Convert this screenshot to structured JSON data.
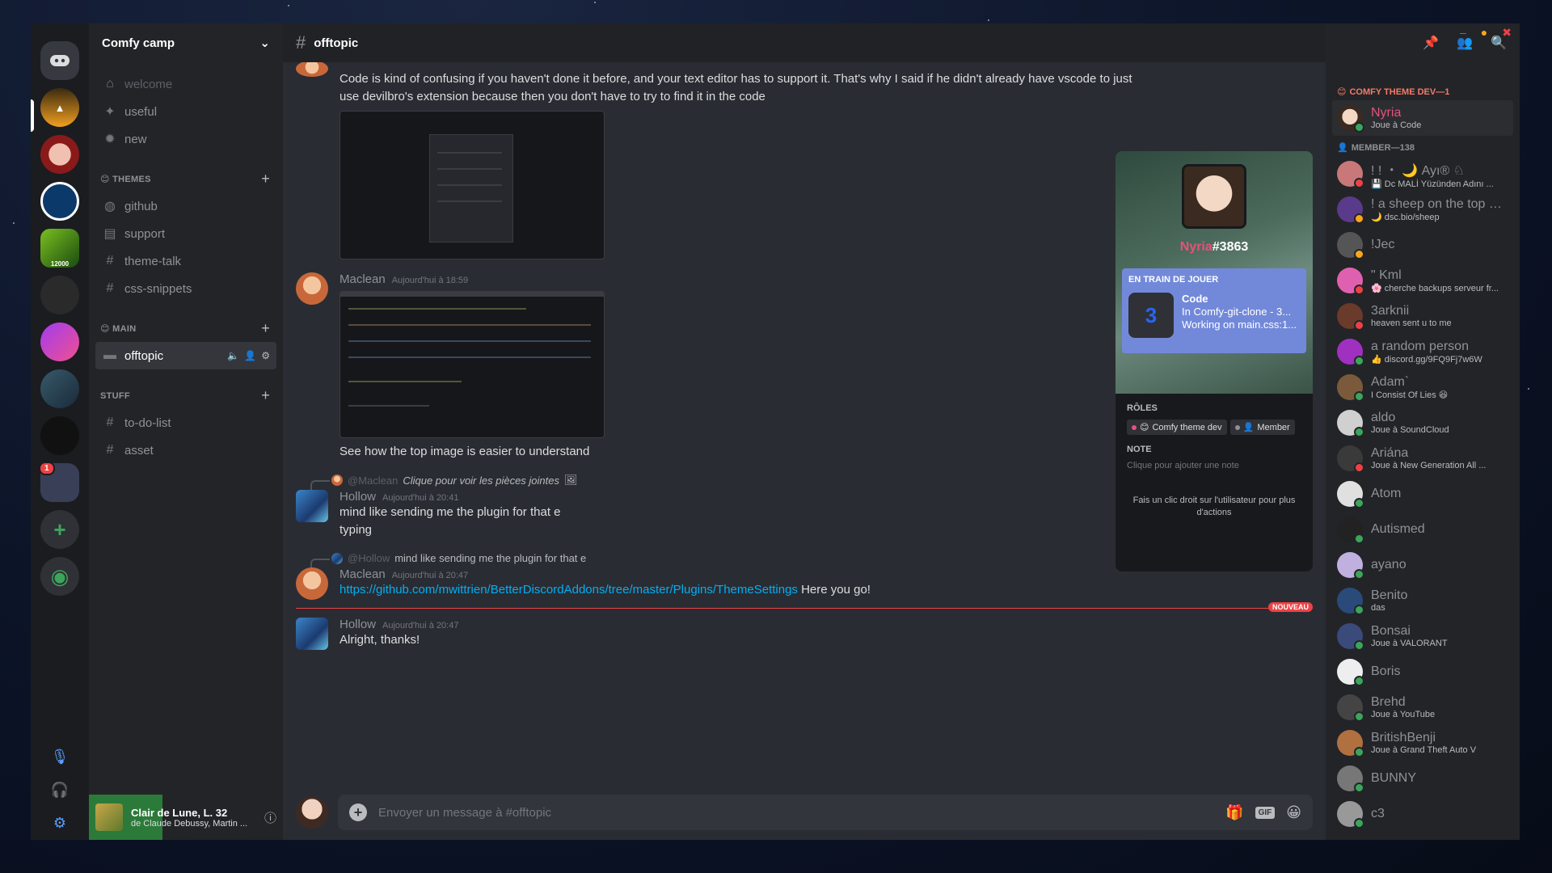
{
  "server": {
    "name": "Comfy camp"
  },
  "rail": {
    "badge": "1",
    "tile_label": "12000"
  },
  "channels": {
    "top": [
      {
        "name": "welcome",
        "icon": "home-icon"
      },
      {
        "name": "useful",
        "icon": "pin-icon"
      },
      {
        "name": "new",
        "icon": "badge-icon"
      }
    ],
    "themes_label": "THEMES",
    "themes": [
      {
        "name": "github",
        "icon": "github-icon"
      },
      {
        "name": "support",
        "icon": "forum-icon"
      },
      {
        "name": "theme-talk",
        "icon": "hash-icon"
      },
      {
        "name": "css-snippets",
        "icon": "hash-icon"
      }
    ],
    "main_label": "MAIN",
    "main": [
      {
        "name": "offtopic",
        "icon": "text-icon",
        "active": true
      }
    ],
    "stuff_label": "STUFF",
    "stuff": [
      {
        "name": "to-do-list",
        "icon": "hash-icon"
      },
      {
        "name": "asset",
        "icon": "hash-icon"
      }
    ]
  },
  "now_playing": {
    "title": "Clair de Lune, L. 32",
    "artist": "de Claude Debussy, Martin ..."
  },
  "chat": {
    "channel": "offtopic",
    "messages": [
      {
        "text": "Code is kind of confusing if you haven't done it before, and your text editor has to support it.  That's why I said if he didn't already have vscode to just use devilbro's extension because then you don't have to try to find it in the code"
      },
      {
        "author": "Maclean",
        "time": "Aujourd'hui à 18:59",
        "text": "See how the top image is easier to understand"
      },
      {
        "reply_mention": "@Maclean",
        "reply_text": "Clique pour voir les pièces jointes",
        "author": "Hollow",
        "time": "Aujourd'hui à 20:41",
        "line1": "mind like sending me the plugin for that e",
        "line2": "typing"
      },
      {
        "reply_mention": "@Hollow",
        "reply_text": "mind like sending me the plugin for that e",
        "author": "Maclean",
        "time": "Aujourd'hui à 20:47",
        "link": "https://github.com/mwittrien/BetterDiscordAddons/tree/master/Plugins/ThemeSettings",
        "after_link": " Here you go!"
      },
      {
        "author": "Hollow",
        "time": "Aujourd'hui à 20:47",
        "text": "Alright, thanks!"
      }
    ],
    "new_label": "NOUVEAU",
    "composer_placeholder": "Envoyer un message à #offtopic",
    "gif_label": "GIF"
  },
  "popout": {
    "name": "Nyria",
    "tag": "#3863",
    "activity_label": "EN TRAIN DE JOUER",
    "activity_game": "Code",
    "activity_line1": "In Comfy-git-clone - 3...",
    "activity_line2": "Working on main.css:1...",
    "roles_label": "RÔLES",
    "roles": [
      {
        "name": "Comfy theme dev",
        "color": "#e5527a"
      },
      {
        "name": "Member",
        "color": "#8e9297"
      }
    ],
    "note_label": "NOTE",
    "note_placeholder": "Clique pour ajouter une note",
    "hint": "Fais un clic droit sur l'utilisateur pour plus d'actions"
  },
  "members": {
    "dev_group": "COMFY THEME DEV—1",
    "member_group": "MEMBER—138",
    "dev": [
      {
        "name": "Nyria",
        "sub": "Joue à Code",
        "color": "#e5527a"
      }
    ],
    "list": [
      {
        "name": "! ! ・ 🌙 Ayı® ♘",
        "sub": "💾 Dc MALİ Yüzünden Adını ...",
        "status": "#ed4245"
      },
      {
        "name": "! a sheep on the top of ...",
        "sub": "🌙 dsc.bio/sheep",
        "status": "#faa61a"
      },
      {
        "name": "!Jec",
        "sub": "",
        "status": "#faa61a"
      },
      {
        "name": "\" Kml",
        "sub": "🌸 cherche backups serveur fr...",
        "status": "#ed4245"
      },
      {
        "name": "3arknii",
        "sub": "heaven sent u to me",
        "status": "#ed4245"
      },
      {
        "name": "a random person",
        "sub": "👍 discord.gg/9FQ9Fj7w6W",
        "status": "#3ba55c"
      },
      {
        "name": "Adam`",
        "sub": "I Consist Of Lies 😆",
        "status": "#3ba55c"
      },
      {
        "name": "aldo",
        "sub": "Joue à SoundCloud",
        "status": "#3ba55c"
      },
      {
        "name": "Ariána",
        "sub": "Joue à New Generation All ...",
        "status": "#ed4245"
      },
      {
        "name": "Atom",
        "sub": "",
        "status": "#3ba55c"
      },
      {
        "name": "Autismed",
        "sub": "",
        "status": "#3ba55c"
      },
      {
        "name": "ayano",
        "sub": "",
        "status": "#3ba55c"
      },
      {
        "name": "Benito",
        "sub": "das",
        "status": "#3ba55c"
      },
      {
        "name": "Bonsai",
        "sub": "Joue à VALORANT",
        "status": "#3ba55c"
      },
      {
        "name": "Boris",
        "sub": "",
        "status": "#3ba55c"
      },
      {
        "name": "Brehd",
        "sub": "Joue à YouTube",
        "status": "#3ba55c"
      },
      {
        "name": "BritishBenji",
        "sub": "Joue à Grand Theft Auto V",
        "status": "#3ba55c"
      },
      {
        "name": "BUNNY",
        "sub": "",
        "status": "#3ba55c"
      },
      {
        "name": "c3",
        "sub": "",
        "status": "#3ba55c"
      }
    ]
  }
}
